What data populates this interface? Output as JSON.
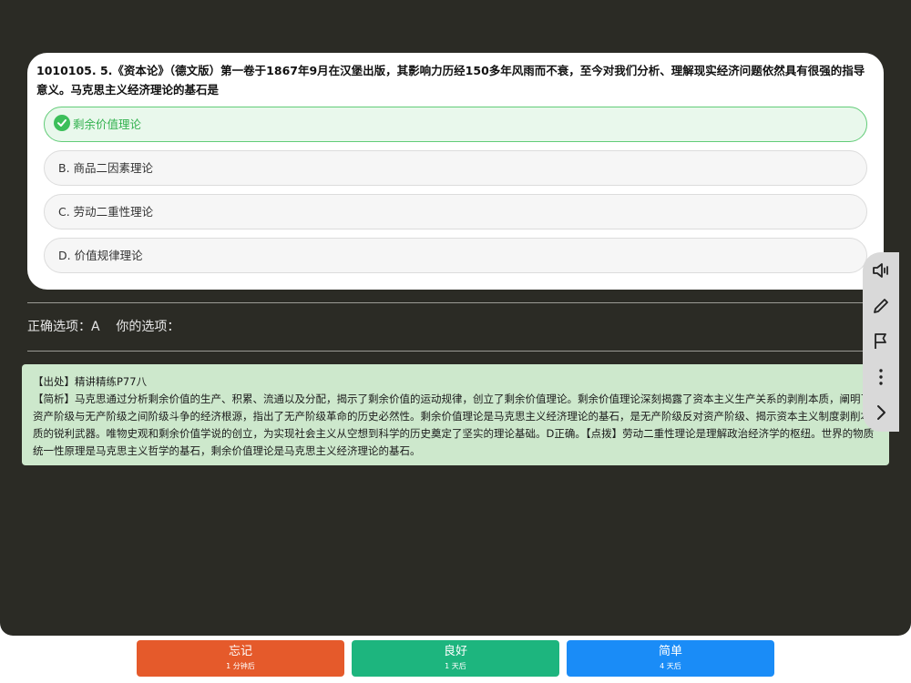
{
  "question": {
    "text": "1010105. 5.《资本论》（德文版）第一卷于1867年9月在汉堡出版，其影响力历经150多年风雨而不衰，至今对我们分析、理解现实经济问题依然具有很强的指导意义。马克思主义经济理论的基石是",
    "options": [
      {
        "label": "剩余价值理论",
        "state": "correct"
      },
      {
        "label": "B. 商品二因素理论",
        "state": "normal"
      },
      {
        "label": "C. 劳动二重性理论",
        "state": "normal"
      },
      {
        "label": "D. 价值规律理论",
        "state": "normal"
      }
    ]
  },
  "answer": {
    "correct_label": "正确选项：",
    "correct_value": "A",
    "yours_label": "你的选项："
  },
  "explanation": {
    "source": "【出处】精讲精练P77八",
    "analysis": "【简析】马克思通过分析剩余价值的生产、积累、流通以及分配，揭示了剩余价值的运动规律，创立了剩余价值理论。剩余价值理论深刻揭露了资本主义生产关系的剥削本质，阐明了资产阶级与无产阶级之间阶级斗争的经济根源，指出了无产阶级革命的历史必然性。剩余价值理论是马克思主义经济理论的基石，是无产阶级反对资产阶级、揭示资本主义制度剥削本质的锐利武器。唯物史观和剩余价值学说的创立，为实现社会主义从空想到科学的历史奠定了坚实的理论基础。D正确。【点拨】劳动二重性理论是理解政治经济学的枢纽。世界的物质统一性原理是马克思主义哲学的基石，剩余价值理论是马克思主义经济理论的基石。"
  },
  "toolbar": {
    "icons": [
      "speaker-icon",
      "pencil-icon",
      "flag-icon",
      "more-vertical-icon",
      "chevron-right-icon"
    ]
  },
  "actions": [
    {
      "label": "忘记",
      "sub": "1 分钟后",
      "color": "#e55a2b"
    },
    {
      "label": "良好",
      "sub": "1 天后",
      "color": "#1db57e"
    },
    {
      "label": "简单",
      "sub": "4 天后",
      "color": "#1a8cf7"
    }
  ]
}
